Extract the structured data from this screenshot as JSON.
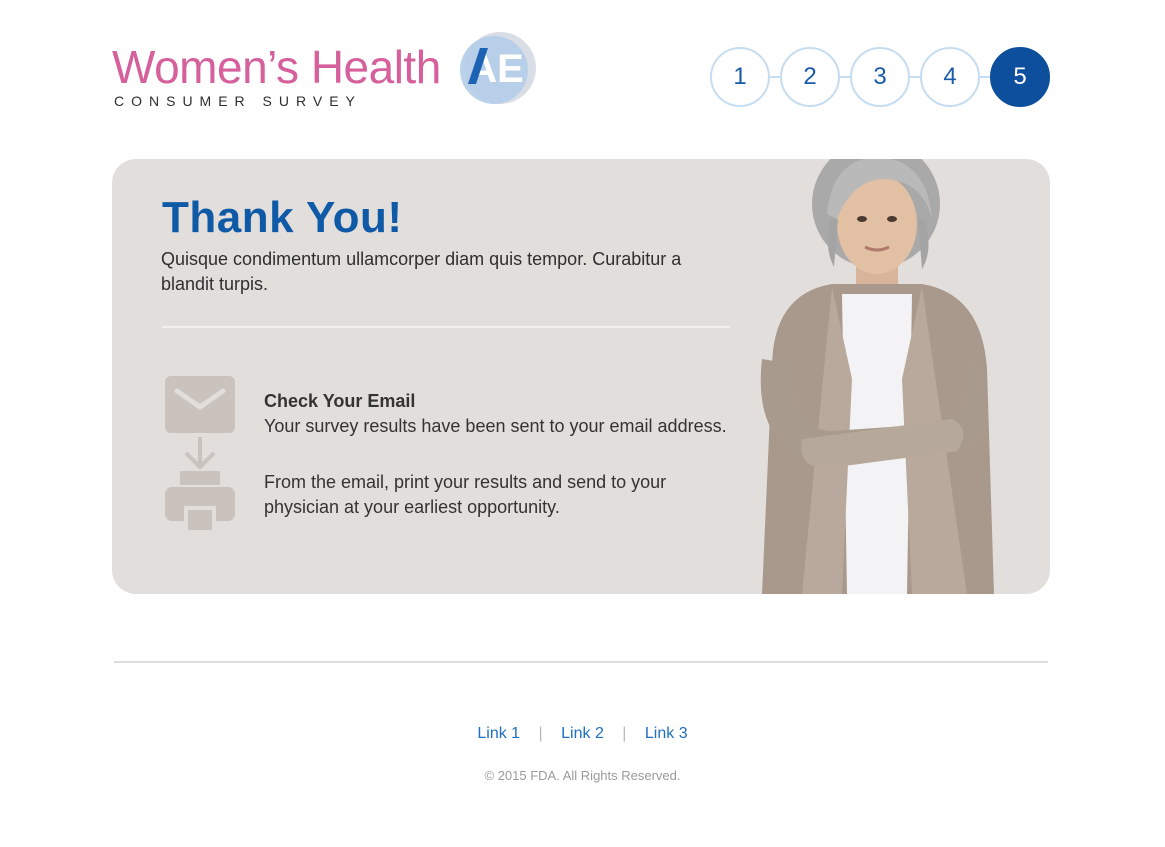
{
  "logo": {
    "title": "Women’s Health",
    "badge": "AE",
    "subtitle": "CONSUMER SURVEY"
  },
  "steps": [
    "1",
    "2",
    "3",
    "4",
    "5"
  ],
  "active_step": "5",
  "card": {
    "title": "Thank You!",
    "lead": "Quisque condimentum ullamcorper diam quis tempor. Curabitur a blandit turpis.",
    "email_heading": "Check Your Email",
    "email_text": "Your survey results have been sent to your email address.",
    "print_text": "From the email, print your results and send to your physician at your earliest opportunity."
  },
  "icons": [
    "envelope-icon",
    "down-arrow-icon",
    "printer-icon"
  ],
  "footer": {
    "links": [
      "Link 1",
      "Link 2",
      "Link 3"
    ],
    "separator": "|",
    "copyright": "© 2015 FDA. All Rights Reserved."
  },
  "colors": {
    "brand_pink": "#d6609c",
    "brand_blue": "#0f5aa6",
    "active_step": "#0d4f9c",
    "card_bg": "#e2dedb",
    "link": "#1f6fc0"
  }
}
